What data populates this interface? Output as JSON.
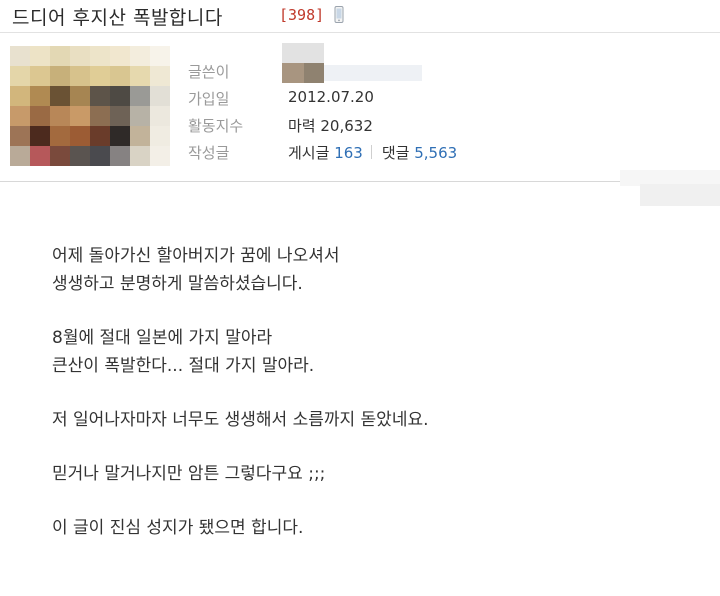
{
  "post": {
    "title": "드디어 후지산 폭발합니다",
    "comment_count": "[398]",
    "mobile_icon": "phone-icon"
  },
  "author": {
    "labels": {
      "writer": "글쓴이",
      "joined": "가입일",
      "activity": "활동지수",
      "posts": "작성글"
    },
    "joined": "2012.07.20",
    "activity_label": "마력",
    "activity_value": "20,632",
    "posts_label": "게시글",
    "posts_count": "163",
    "comments_label": "댓글",
    "comments_count": "5,563"
  },
  "content": {
    "paragraphs": [
      [
        "어제 돌아가신 할아버지가 꿈에 나오셔서",
        "생생하고 분명하게 말씀하셨습니다."
      ],
      [
        "8월에 절대 일본에 가지 말아라",
        "큰산이 폭발한다... 절대 가지 말아라."
      ],
      [
        "저 일어나자마자 너무도 생생해서 소름까지 돋았네요."
      ],
      [
        "믿거나 말거나지만 암튼 그렇다구요 ;;;"
      ],
      [
        "이 글이 진심 성지가 됐으면 합니다."
      ]
    ]
  },
  "colors": {
    "comment_count": "#c0392b",
    "link_numbers": "#2f6fb5",
    "label_gray": "#9a9a9a"
  }
}
